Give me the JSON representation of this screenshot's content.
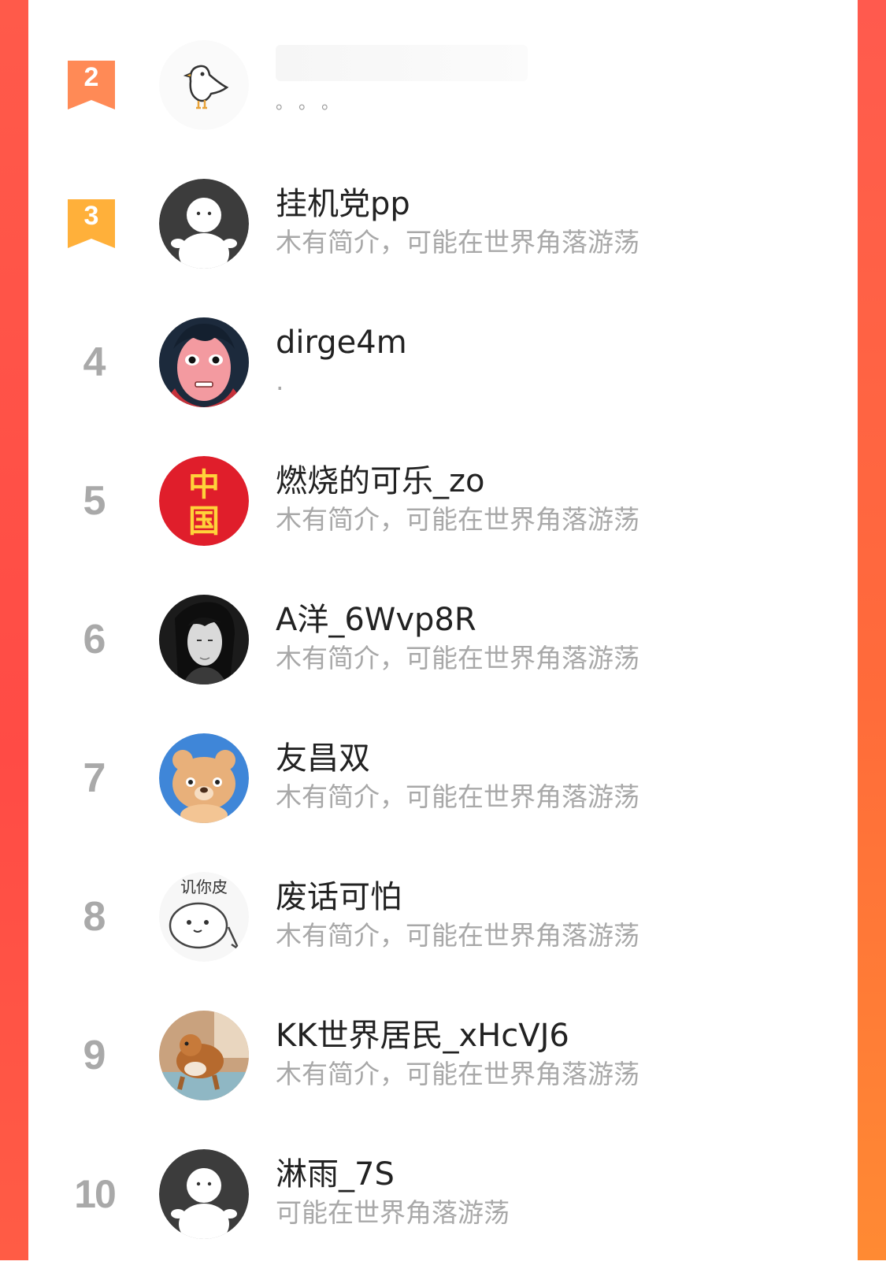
{
  "colors": {
    "badge_2": "#ff8a56",
    "badge_3": "#ffb03a",
    "rank_gray": "#a9a9a9",
    "name": "#222222",
    "bio": "#a8a8a8"
  },
  "rankings": [
    {
      "rank": "2",
      "name": "",
      "bio": "。。。",
      "avatar": "bird-avatar"
    },
    {
      "rank": "3",
      "name": "挂机党pp",
      "bio": "木有简介，可能在世界角落游荡",
      "avatar": "default-avatar"
    },
    {
      "rank": "4",
      "name": "dirge4m",
      "bio": ".",
      "avatar": "cartoon-girl-avatar"
    },
    {
      "rank": "5",
      "name": "燃烧的可乐_zo",
      "bio": "木有简介，可能在世界角落游荡",
      "avatar": "china-flag-avatar"
    },
    {
      "rank": "6",
      "name": "A洋_6Wvp8R",
      "bio": "木有简介，可能在世界角落游荡",
      "avatar": "anime-man-avatar"
    },
    {
      "rank": "7",
      "name": "友昌双",
      "bio": "木有简介，可能在世界角落游荡",
      "avatar": "bear-avatar"
    },
    {
      "rank": "8",
      "name": "废话可怕",
      "bio": "木有简介，可能在世界角落游荡",
      "avatar": "sticker-avatar",
      "avatar_text": "讥你皮"
    },
    {
      "rank": "9",
      "name": "KK世界居民_xHcVJ6",
      "bio": "木有简介，可能在世界角落游荡",
      "avatar": "dog-photo-avatar"
    },
    {
      "rank": "10",
      "name": "淋雨_7S",
      "bio": "可能在世界角落游荡",
      "avatar": "default-avatar"
    }
  ]
}
